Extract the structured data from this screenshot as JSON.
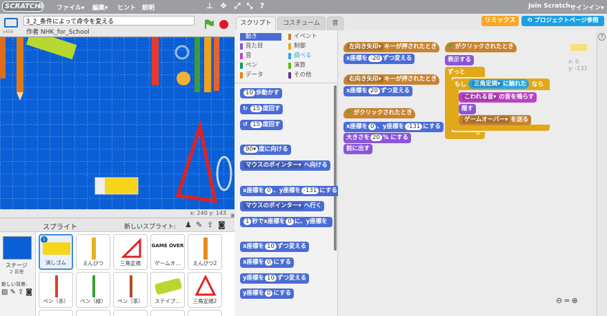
{
  "menubar": {
    "logo": "SCRATCH",
    "file": "ファイル▾",
    "edit": "編集▾",
    "hint": "ヒント",
    "about": "説明",
    "join": "Join Scratch",
    "signin": "サインイン▾"
  },
  "header": {
    "project_title": "3_2_条件によって命令を変える",
    "author": "作者 NHK_for_School",
    "version": "v454"
  },
  "stage": {
    "coords": "x: 240  y: 143"
  },
  "tabs": [
    {
      "label": "スクリプト"
    },
    {
      "label": "コスチューム"
    },
    {
      "label": "音"
    }
  ],
  "buttons": {
    "remix": "リミックス",
    "project_page": "プロジェクトページ参照"
  },
  "categories": {
    "left": [
      "動き",
      "見た目",
      "音",
      "ペン",
      "データ"
    ],
    "right": [
      "イベント",
      "制御",
      "調べる",
      "演算",
      "その他"
    ]
  },
  "palette": {
    "move": [
      "10",
      "歩動かす"
    ],
    "turn_right": [
      "15",
      "度回す"
    ],
    "turn_left": [
      "15",
      "度回す"
    ],
    "point_dir": [
      "90▾",
      "度に向ける"
    ],
    "point_toward": [
      "マウスのポインター▾",
      "へ向ける"
    ],
    "goto_xy": [
      "x座標を",
      "0",
      "、y座標を",
      "-131",
      "にする"
    ],
    "goto": [
      "マウスのポインター▾",
      "へ行く"
    ],
    "glide": [
      "1",
      "秒でx座標を",
      "0",
      "に、y座標を"
    ],
    "change_x": [
      "x座標を",
      "10",
      "ずつ変える"
    ],
    "set_x": [
      "x座標を",
      "0",
      "にする"
    ],
    "change_y": [
      "y座標を",
      "10",
      "ずつ変える"
    ],
    "set_y": [
      "y座標を",
      "0",
      "にする"
    ]
  },
  "script1": {
    "hat": [
      "左向き矢印▾",
      "キーが押されたとき"
    ],
    "b1": [
      "x座標を",
      "-20",
      "ずつ変える"
    ]
  },
  "script2": {
    "hat": [
      "右向き矢印▾",
      "キーが押されたとき"
    ],
    "b1": [
      "x座標を",
      "20",
      "ずつ変える"
    ]
  },
  "script3": {
    "hat": "がクリックされたとき",
    "b1": [
      "x座標を",
      "0",
      "、y座標を",
      "-131",
      "にする"
    ],
    "b2": [
      "大きさを",
      "20",
      "% にする"
    ],
    "b3": "前に出す"
  },
  "script4": {
    "hat": "がクリックされたとき",
    "b1": "表示する",
    "forever": "ずっと",
    "if": "もし",
    "touching": [
      "三角定規▾",
      "に触れた"
    ],
    "then": "なら",
    "sound": [
      "こわれる音▾",
      "の音を鳴らす"
    ],
    "hide": "隠す",
    "broadcast": [
      "ゲームオーバー▾",
      "を送る"
    ]
  },
  "xy_readout": {
    "x": "x: 0",
    "y": "y: -131"
  },
  "sprites": {
    "header": "スプライト",
    "new_sprite": "新しいスプライト:",
    "stage_label": "ステージ",
    "stage_backdrops": "2 背景",
    "new_backdrop": "新しい背景:",
    "items": [
      "消しゴム",
      "えんぴつ",
      "三角定規",
      "ゲームオ…",
      "えんぴつ2",
      "ペン（赤）",
      "ペン（緑）",
      "ペン（茶）",
      "ステイプ…",
      "三角定規2"
    ],
    "gameover_thumb": "GAME OVER"
  },
  "colors": {
    "menubar": "#9c9ea2",
    "motion": "#4a6cd4",
    "looks": "#8a55d7",
    "sound": "#bb42c3",
    "events": "#c88330",
    "control": "#e1a91a",
    "sensing": "#2ca5e2",
    "remix": "#f7a823",
    "project_page": "#1ba1e2"
  }
}
